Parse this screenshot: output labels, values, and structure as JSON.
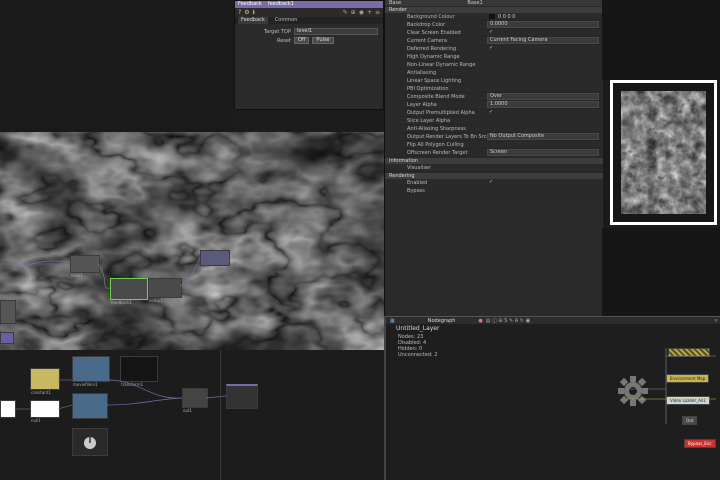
{
  "feedback_panel": {
    "title": "Feedback",
    "op_name": "feedback1",
    "tabs": [
      "Feedback",
      "Common"
    ],
    "target_label": "Target TOP",
    "target_value": "level1",
    "reset_label": "Reset",
    "reset_state": "Off",
    "pulse_label": "Pulse"
  },
  "render_panel": {
    "header_left": "Base",
    "header_right": "Base1",
    "sections": [
      {
        "title": "Render",
        "rows": [
          {
            "name": "Background Colour",
            "value": "0  0  0  0",
            "type": "color"
          },
          {
            "name": "Backdrop Color",
            "value": "0.0000",
            "type": "box"
          },
          {
            "name": "Clear Screen Enabled",
            "value": "✓",
            "type": "plain"
          },
          {
            "name": "Current Camera",
            "value": "Current Facing Camera",
            "type": "box"
          },
          {
            "name": "Deferred Rendering",
            "value": "✓",
            "type": "plain"
          },
          {
            "name": "High Dynamic Range",
            "value": "",
            "type": "plain"
          },
          {
            "name": "Non-Linear Dynamic Range",
            "value": "",
            "type": "dim"
          },
          {
            "name": "Antialiasing",
            "value": "",
            "type": "plain"
          },
          {
            "name": "Linear Space Lighting",
            "value": "",
            "type": "plain"
          },
          {
            "name": "PBI Optimization",
            "value": "",
            "type": "plain"
          },
          {
            "name": "Composite Blend Mode",
            "value": "Over",
            "type": "box"
          },
          {
            "name": "Layer Alpha",
            "value": "1.0000",
            "type": "box"
          },
          {
            "name": "Output Premultiplied Alpha",
            "value": "✓",
            "type": "plain"
          },
          {
            "name": "Slice Layer Alpha",
            "value": "",
            "type": "plain"
          },
          {
            "name": "Anti-Aliasing Sharpness",
            "value": "",
            "type": "dim"
          },
          {
            "name": "Output Render Layers To Bn Srcs",
            "value": "No Output Composite",
            "type": "box"
          },
          {
            "name": "Flip All Polygon Culling",
            "value": "",
            "type": "plain"
          },
          {
            "name": "Offscreen Render Target",
            "value": "Screen",
            "type": "box"
          }
        ]
      },
      {
        "title": "Information",
        "rows": [
          {
            "name": "Visualiser",
            "value": "",
            "type": "plain"
          }
        ]
      },
      {
        "title": "Rendering",
        "rows": [
          {
            "name": "Enabled",
            "value": "✓",
            "type": "plain"
          },
          {
            "name": "Bypass",
            "value": "",
            "type": "plain"
          }
        ]
      }
    ]
  },
  "nodegraph": {
    "tab_label": "Nodegraph",
    "layer_title": "Untitled_Layer",
    "stats": [
      {
        "label": "Nodes:",
        "value": "23"
      },
      {
        "label": "Disabled:",
        "value": "4"
      },
      {
        "label": "Hidden:",
        "value": "0"
      },
      {
        "label": "Unconnected:",
        "value": "2"
      }
    ],
    "nodes": {
      "environment": "Environment Map",
      "video_loader": "Video Loader_A01",
      "bypass": "Bypass_Enc",
      "out": "Out"
    }
  },
  "network_labels": {
    "level": "level1",
    "feedback": "feedback1",
    "constant": "constant1",
    "transform": "transform1",
    "null": "null1",
    "out": "out1",
    "movie": "moviefilein1",
    "noise": "noise1",
    "comp": "comp1"
  },
  "colors": {
    "accent_purple": "#7a6ba6",
    "node_selected": "#6fd24a",
    "bypass_red": "#d03030",
    "yellow_node": "#d6c86a"
  }
}
